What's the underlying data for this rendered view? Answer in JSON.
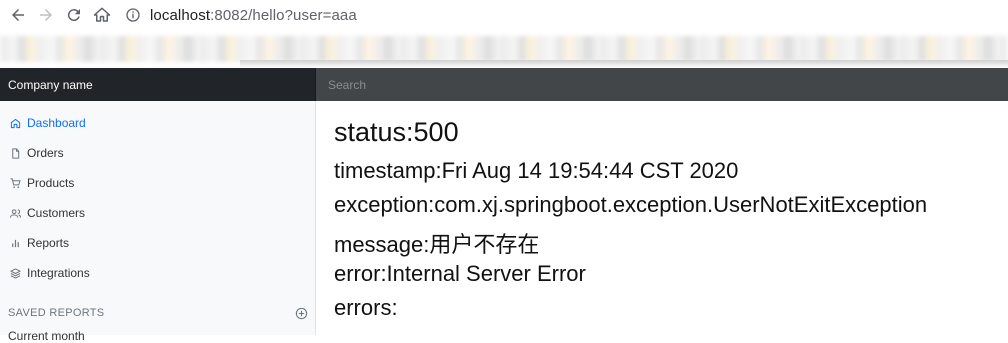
{
  "browser": {
    "url_host": "localhost",
    "url_rest": ":8082/hello?user=aaa",
    "icons": [
      "back-arrow-icon",
      "forward-arrow-icon",
      "reload-icon",
      "home-icon",
      "info-icon"
    ]
  },
  "header": {
    "brand": "Company name",
    "search_placeholder": "Search"
  },
  "sidebar": {
    "items": [
      {
        "label": "Dashboard",
        "icon": "home-icon",
        "active": true
      },
      {
        "label": "Orders",
        "icon": "file-icon"
      },
      {
        "label": "Products",
        "icon": "cart-icon"
      },
      {
        "label": "Customers",
        "icon": "users-icon"
      },
      {
        "label": "Reports",
        "icon": "bar-chart-icon"
      },
      {
        "label": "Integrations",
        "icon": "layers-icon"
      }
    ],
    "saved_heading": "SAVED REPORTS",
    "saved_first": "Current month"
  },
  "error_page": {
    "status": "status:500",
    "timestamp": "timestamp:Fri Aug 14 19:54:44 CST 2020",
    "exception": "exception:com.xj.springboot.exception.UserNotExitException",
    "message": "message:用户不存在",
    "error": "error:Internal Server Error",
    "errors": "errors:"
  },
  "colors": {
    "brand_bg": "#212529",
    "search_bg": "#424649",
    "active": "#0d6efd"
  }
}
